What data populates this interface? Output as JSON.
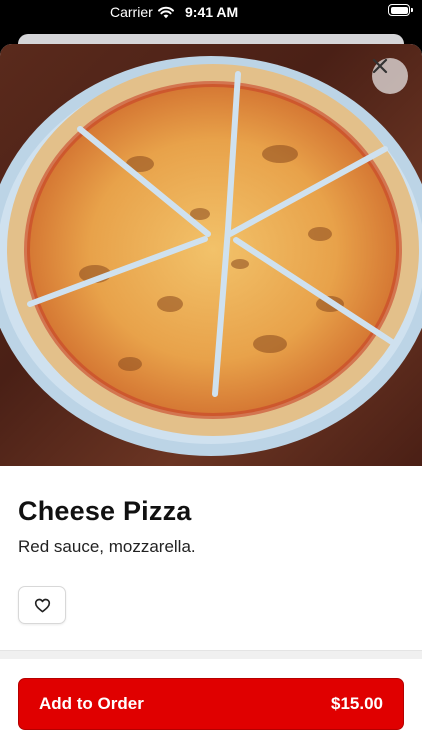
{
  "status_bar": {
    "carrier": "Carrier",
    "time": "9:41 AM",
    "icons": [
      "wifi-icon",
      "battery-icon"
    ]
  },
  "product": {
    "image_alt": "cheese pizza photo",
    "name": "Cheese Pizza",
    "description": "Red sauce, mozzarella.",
    "favorite_icon": "heart-icon"
  },
  "actions": {
    "close_icon": "close-icon",
    "add_label": "Add to Order",
    "price": "$15.00"
  },
  "colors": {
    "accent": "#e00000",
    "text": "#111111"
  }
}
